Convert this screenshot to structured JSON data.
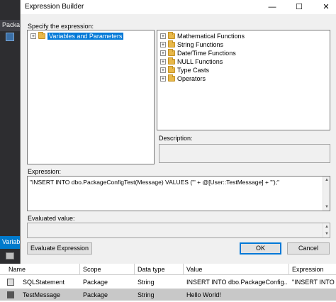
{
  "ide": {
    "tab_top": "Package",
    "tab_bottom": "Variables"
  },
  "dialog": {
    "title": "Expression Builder",
    "specify_label": "Specify the expression:",
    "left_tree": {
      "root_label": "Variables and Parameters",
      "root_expander": "+"
    },
    "right_tree": [
      {
        "label": "Mathematical Functions",
        "expander": "+"
      },
      {
        "label": "String Functions",
        "expander": "+"
      },
      {
        "label": "Date/Time Functions",
        "expander": "+"
      },
      {
        "label": "NULL Functions",
        "expander": "+"
      },
      {
        "label": "Type Casts",
        "expander": "+"
      },
      {
        "label": "Operators",
        "expander": "+"
      }
    ],
    "description_label": "Description:",
    "description_value": "",
    "expression_label": "Expression:",
    "expression_value": "\"INSERT INTO dbo.PackageConfigTest(Message) VALUES ('\" + @[User::TestMessage]  + \"');\"",
    "evaluated_label": "Evaluated value:",
    "evaluated_value": "",
    "evaluate_button": "Evaluate Expression",
    "ok_button": "OK",
    "cancel_button": "Cancel"
  },
  "variables_grid": {
    "columns": [
      "Name",
      "Scope",
      "Data type",
      "Value",
      "Expression"
    ],
    "rows": [
      {
        "name": "SQLStatement",
        "scope": "Package",
        "data_type": "String",
        "value": "INSERT INTO dbo.PackageConfig...",
        "expression": "\"INSERT INTO d"
      },
      {
        "name": "TestMessage",
        "scope": "Package",
        "data_type": "String",
        "value": "Hello World!",
        "expression": ""
      }
    ]
  },
  "colors": {
    "selection": "#0078d7",
    "ide_background": "#2d2d30",
    "dialog_background": "#f0f0f0"
  }
}
